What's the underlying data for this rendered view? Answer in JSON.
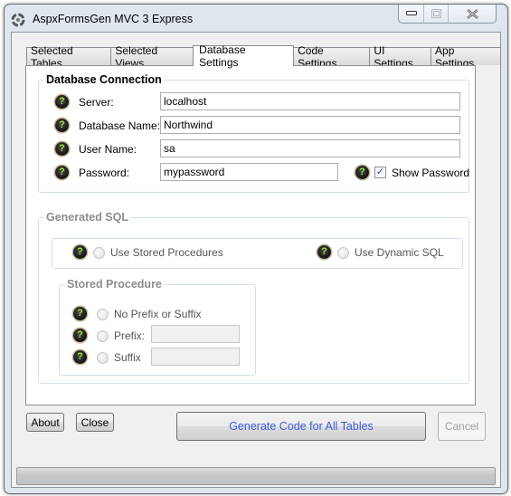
{
  "window": {
    "title": "AspxFormsGen MVC 3 Express",
    "caption_buttons": {
      "minimize": "minimize-icon",
      "maximize": "maximize-icon",
      "close": "close-icon"
    }
  },
  "tabs": [
    {
      "label": "Selected Tables",
      "active": false
    },
    {
      "label": "Selected Views",
      "active": false
    },
    {
      "label": "Database Settings",
      "active": true
    },
    {
      "label": "Code Settings",
      "active": false
    },
    {
      "label": "UI Settings",
      "active": false
    },
    {
      "label": "App Settings",
      "active": false
    }
  ],
  "database_connection": {
    "legend": "Database Connection",
    "server": {
      "label": "Server:",
      "value": "localhost"
    },
    "database_name": {
      "label": "Database Name:",
      "value": "Northwind"
    },
    "user_name": {
      "label": "User Name:",
      "value": "sa"
    },
    "password": {
      "label": "Password:",
      "value": "mypassword"
    },
    "show_password": {
      "label": "Show Password",
      "checked": true
    }
  },
  "generated_sql": {
    "legend": "Generated SQL",
    "use_stored_procedures": {
      "label": "Use Stored Procedures",
      "selected": false
    },
    "use_dynamic_sql": {
      "label": "Use Dynamic SQL",
      "selected": false
    },
    "stored_procedure": {
      "legend": "Stored Procedure",
      "no_prefix_suffix": {
        "label": "No Prefix or Suffix"
      },
      "prefix": {
        "label": "Prefix:",
        "value": ""
      },
      "suffix": {
        "label": "Suffix",
        "value": ""
      }
    }
  },
  "buttons": {
    "about": "About",
    "close": "Close",
    "generate": "Generate Code for All Tables",
    "cancel": "Cancel"
  },
  "help_icon_glyph": "?",
  "check_glyph": "✓",
  "progress": {
    "value": 0
  }
}
